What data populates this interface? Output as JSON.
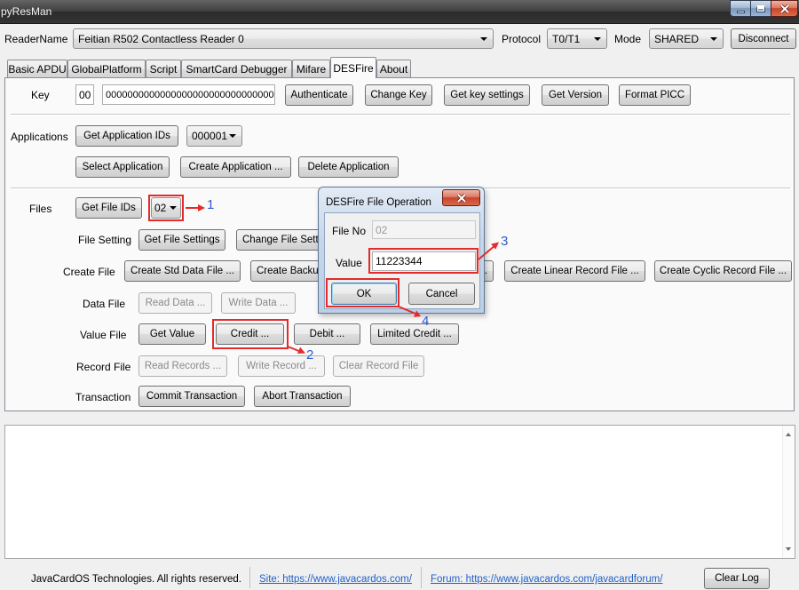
{
  "window": {
    "title": "pyResMan",
    "controls": {
      "minimize": "minimize-icon",
      "maximize": "maximize-icon",
      "close": "close-icon"
    }
  },
  "toolbar": {
    "reader_label": "ReaderName",
    "reader_value": "Feitian R502 Contactless Reader 0",
    "protocol_label": "Protocol",
    "protocol_value": "T0/T1",
    "mode_label": "Mode",
    "mode_value": "SHARED",
    "disconnect_label": "Disconnect"
  },
  "tabs": [
    {
      "label": "Basic APDU",
      "selected": false
    },
    {
      "label": "GlobalPlatform",
      "selected": false
    },
    {
      "label": "Script",
      "selected": false
    },
    {
      "label": "SmartCard Debugger",
      "selected": false
    },
    {
      "label": "Mifare",
      "selected": false
    },
    {
      "label": "DESFire",
      "selected": true
    },
    {
      "label": "About",
      "selected": false
    }
  ],
  "desfire": {
    "key": {
      "label": "Key",
      "key_no": "00",
      "key_value": "00000000000000000000000000000000",
      "authenticate": "Authenticate",
      "change_key": "Change Key",
      "get_key_settings": "Get key settings",
      "get_version": "Get Version",
      "format_picc": "Format PICC"
    },
    "applications": {
      "label": "Applications",
      "get_ids": "Get Application IDs",
      "selected_aid": "000001",
      "select": "Select Application",
      "create": "Create Application ...",
      "delete": "Delete Application"
    },
    "files": {
      "label": "Files",
      "get_ids": "Get File IDs",
      "selected_file": "02",
      "file_setting": {
        "label": "File Setting",
        "get": "Get File Settings",
        "change": "Change File Setti"
      },
      "create_file": {
        "label": "Create File",
        "std": "Create Std Data File ...",
        "backup": "Create Backup",
        "obscured": "...",
        "linear": "Create Linear Record File ...",
        "cyclic": "Create Cyclic Record File ..."
      },
      "data_file": {
        "label": "Data File",
        "read": "Read Data ...",
        "write": "Write Data ..."
      },
      "value_file": {
        "label": "Value File",
        "get": "Get Value",
        "credit": "Credit ...",
        "debit": "Debit ...",
        "limited_credit": "Limited Credit ..."
      },
      "record_file": {
        "label": "Record File",
        "read": "Read Records ...",
        "write": "Write Record ...",
        "clear": "Clear Record File"
      },
      "transaction": {
        "label": "Transaction",
        "commit": "Commit Transaction",
        "abort": "Abort Transaction"
      }
    }
  },
  "dialog": {
    "title": "DESFire File Operation",
    "file_no_label": "File No",
    "file_no_value": "02",
    "value_label": "Value",
    "value_value": "11223344",
    "ok": "OK",
    "cancel": "Cancel"
  },
  "annotations": {
    "step1": "1",
    "step2": "2",
    "step3": "3",
    "step4": "4"
  },
  "footer": {
    "copyright": "JavaCardOS Technologies. All rights reserved.",
    "site_link": "Site: https://www.javacardos.com/",
    "forum_link": "Forum: https://www.javacardos.com/javacardforum/",
    "clear_log": "Clear Log"
  },
  "colors": {
    "highlight_box": "#e32b2b",
    "annotation_number": "#2f5bd0",
    "link": "#1f5fc8"
  }
}
